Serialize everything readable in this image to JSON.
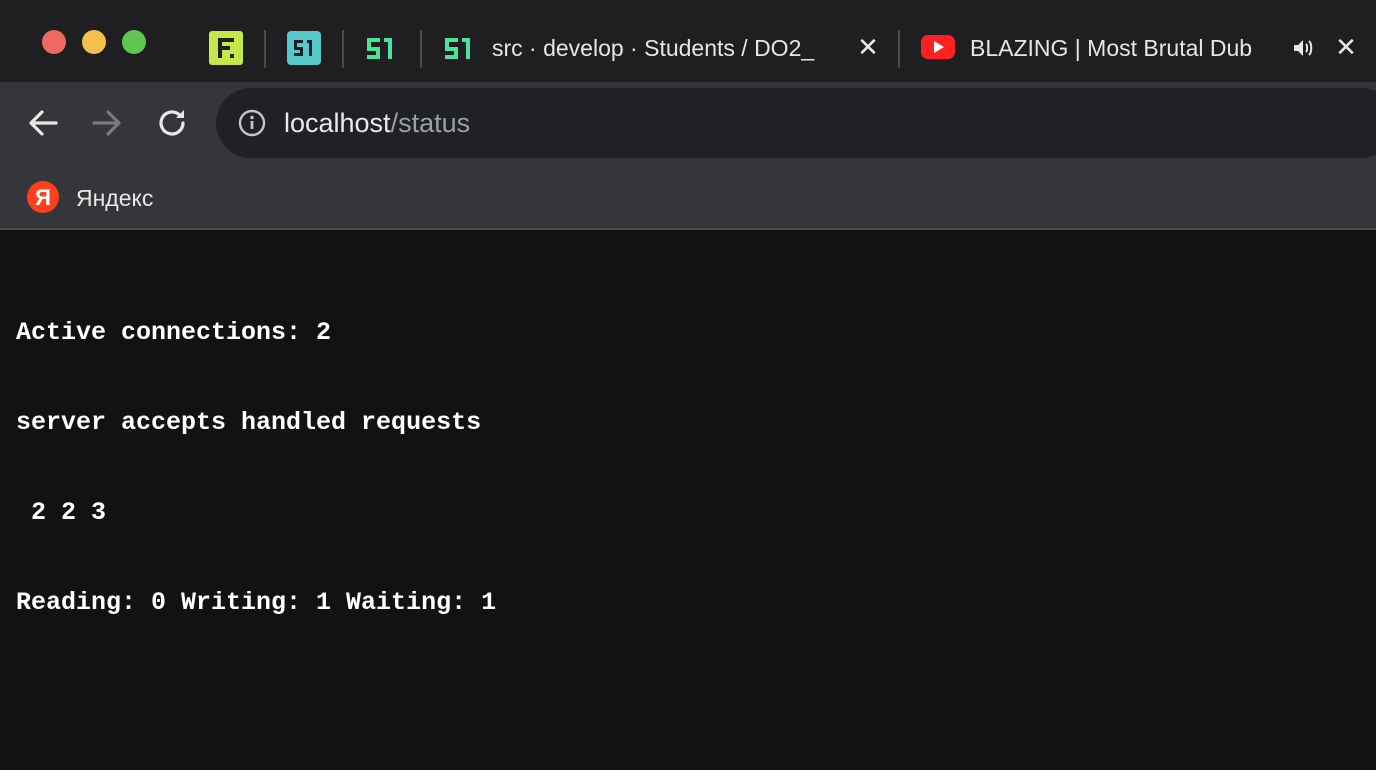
{
  "tabs": {
    "pinned": [
      {
        "name": "figma",
        "icon": "figma-style-f-icon",
        "color": "#c4e84a"
      },
      {
        "name": "21-school-teal",
        "icon": "21-logo-icon",
        "color": "#55c9c9"
      },
      {
        "name": "21-school-green",
        "icon": "21-logo-icon",
        "color": "#4be39a"
      }
    ],
    "items": [
      {
        "title": "src · develop · Students / DO2_",
        "icon": "21-logo-icon",
        "close": "✕"
      },
      {
        "title": "BLAZING | Most Brutal Dub",
        "icon": "youtube-icon",
        "audio": "🔊",
        "close": "✕"
      }
    ]
  },
  "toolbar": {
    "back": "back-arrow-icon",
    "forward": "forward-arrow-icon",
    "reload": "reload-icon",
    "url_host": "localhost",
    "url_path": "/status"
  },
  "bookmarks": {
    "items": [
      {
        "label": "Яндекс",
        "icon": "yandex-icon",
        "icon_letter": "Я",
        "color": "#fc3f1d"
      }
    ]
  },
  "status": {
    "line1": "Active connections: 2",
    "line2": "server accepts handled requests",
    "line3": " 2 2 3",
    "line4": "Reading: 0 Writing: 1 Waiting: 1"
  },
  "colors": {
    "tabstrip": "#1f1f21",
    "toolbar": "#35363a",
    "page": "#121212"
  }
}
